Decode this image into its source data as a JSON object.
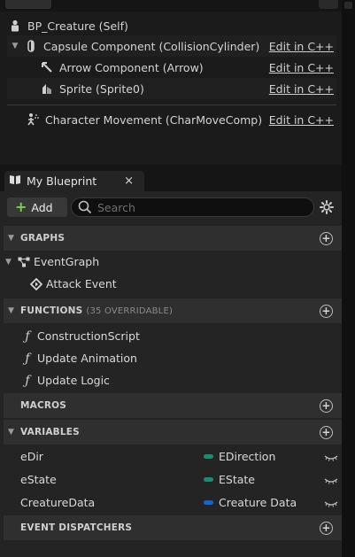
{
  "components": {
    "root": {
      "label": "BP_Creature (Self)"
    },
    "items": [
      {
        "label": "Capsule Component (CollisionCylinder)",
        "edit": "Edit in C++"
      },
      {
        "label": "Arrow Component (Arrow)",
        "edit": "Edit in C++"
      },
      {
        "label": "Sprite (Sprite0)",
        "edit": "Edit in C++"
      },
      {
        "label": "Character Movement (CharMoveComp)",
        "edit": "Edit in C++"
      }
    ]
  },
  "blueprint_tab": {
    "label": "My Blueprint",
    "close": "×"
  },
  "toolbar": {
    "add_label": "Add",
    "search_placeholder": "Search"
  },
  "sections": {
    "graphs": {
      "title": "GRAPHS"
    },
    "functions": {
      "title": "FUNCTIONS",
      "subtitle": "(35 OVERRIDABLE)"
    },
    "macros": {
      "title": "MACROS"
    },
    "variables": {
      "title": "VARIABLES"
    },
    "event_dispatchers": {
      "title": "EVENT DISPATCHERS"
    }
  },
  "graphs": [
    {
      "label": "EventGraph"
    },
    {
      "label": "Attack Event"
    }
  ],
  "functions": [
    {
      "label": "ConstructionScript"
    },
    {
      "label": "Update Animation"
    },
    {
      "label": "Update Logic"
    }
  ],
  "variables": [
    {
      "name": "eDir",
      "type": "EDirection",
      "type_color": "#1f8a73"
    },
    {
      "name": "eState",
      "type": "EState",
      "type_color": "#1f8a73"
    },
    {
      "name": "CreatureData",
      "type": "Creature Data",
      "type_color": "#1464d6"
    }
  ],
  "icons": {
    "root": "actor-icon",
    "capsule": "capsule-icon",
    "arrow": "arrow-icon",
    "sprite": "sprite-icon",
    "movement": "movement-icon",
    "graph": "graph-icon",
    "event": "event-icon",
    "function": "function-icon",
    "add": "plus-icon",
    "search": "search-icon",
    "settings": "gear-icon",
    "visibility": "eye-closed-icon"
  },
  "colors": {
    "add_green": "#7bd14b",
    "enum_teal": "#1f8a73",
    "struct_blue": "#1464d6"
  }
}
